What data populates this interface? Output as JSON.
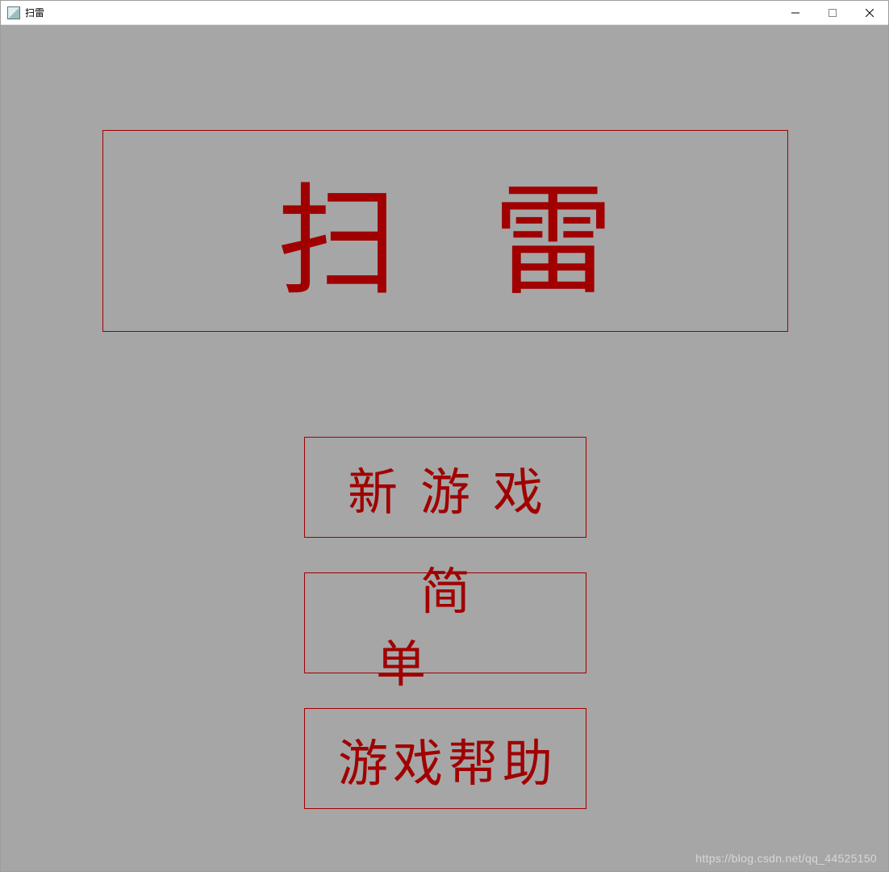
{
  "window": {
    "title": "扫雷"
  },
  "game": {
    "title": "扫 雷",
    "buttons": {
      "new_game": "新游戏",
      "difficulty": "简单",
      "help": "游戏帮助"
    }
  },
  "watermark": "https://blog.csdn.net/qq_44525150"
}
